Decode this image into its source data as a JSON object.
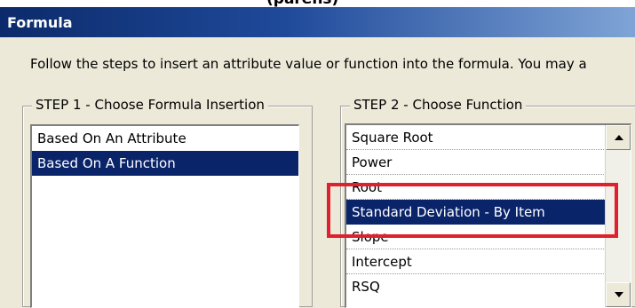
{
  "window": {
    "title": "Formula"
  },
  "instructions": "Follow the steps to insert an attribute value or function into the formula. You may a",
  "step1": {
    "label": "STEP 1 - Choose Formula Insertion",
    "items": [
      {
        "label": "Based On An Attribute",
        "selected": false
      },
      {
        "label": "Based On A Function",
        "selected": true
      }
    ]
  },
  "step2": {
    "label": "STEP 2 - Choose Function",
    "items": [
      {
        "label": "Square Root",
        "selected": false
      },
      {
        "label": "Power",
        "selected": false
      },
      {
        "label": "Root",
        "selected": false
      },
      {
        "label": "Standard Deviation - By Item",
        "selected": true
      },
      {
        "label": "Slope",
        "selected": false
      },
      {
        "label": "Intercept",
        "selected": false
      },
      {
        "label": "RSQ",
        "selected": false
      }
    ]
  },
  "colors": {
    "selection": "#0a246a",
    "highlight": "#e0202c",
    "title_bar": "#0c2a6b"
  },
  "icons": [
    "scroll-up-icon",
    "scroll-down-icon"
  ]
}
